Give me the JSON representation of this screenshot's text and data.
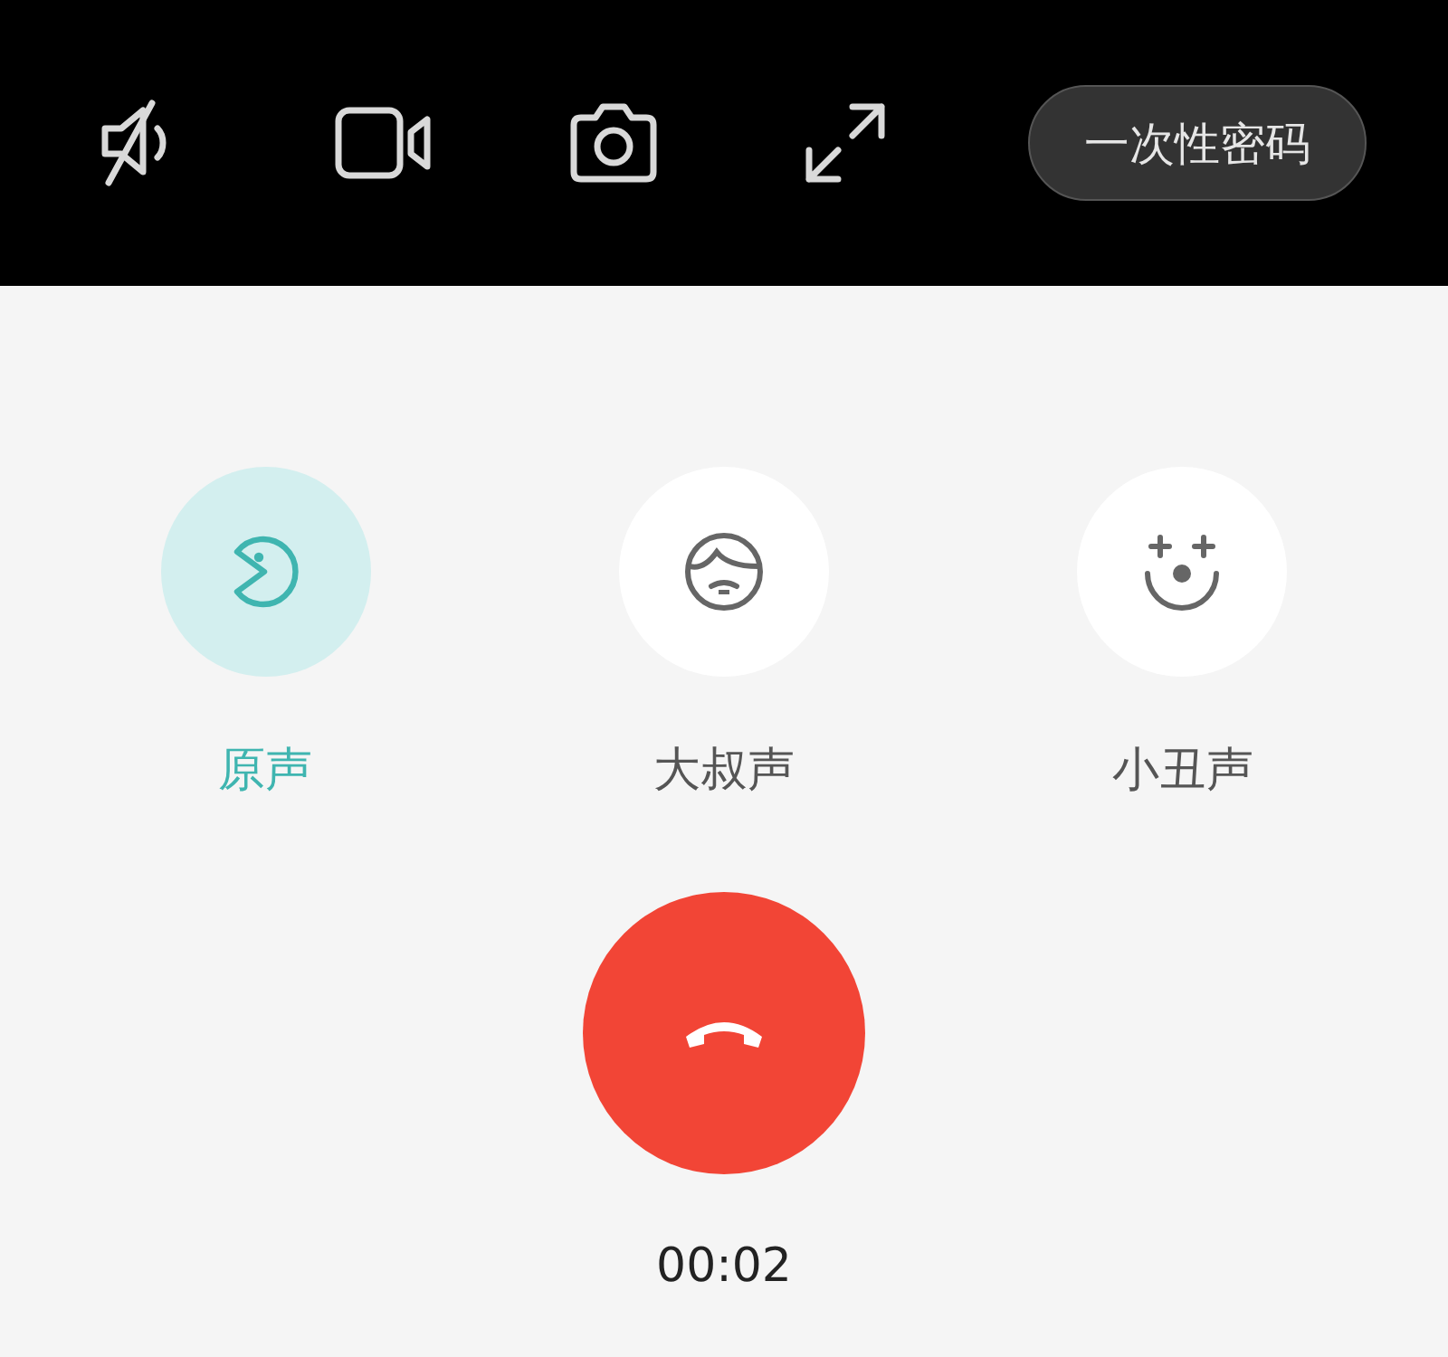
{
  "top_bar": {
    "password_button": "一次性密码"
  },
  "voice_options": [
    {
      "label": "原声",
      "selected": true
    },
    {
      "label": "大叔声",
      "selected": false
    },
    {
      "label": "小丑声",
      "selected": false
    }
  ],
  "call_timer": "00:02"
}
